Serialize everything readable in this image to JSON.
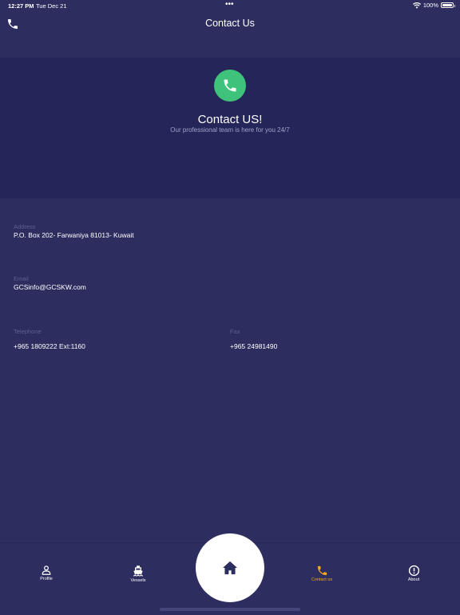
{
  "status_bar": {
    "time": "12:27 PM",
    "date": "Tue Dec 21",
    "dots": "•••",
    "battery_text": "100%",
    "battery_level": 1.0,
    "icons": [
      "wifi-icon",
      "battery-icon"
    ]
  },
  "header": {
    "title": "Contact Us",
    "left_icon": "phone-icon"
  },
  "hero": {
    "icon": "phone-icon",
    "title": "Contact US!",
    "subtitle": "Our professional team is here for you 24/7"
  },
  "contact": {
    "address_label": "Address",
    "address_value": "P.O. Box 202- Farwaniya 81013- Kuwait",
    "email_label": "Email",
    "email_value": "GCSinfo@GCSKW.com",
    "telephone_label": "Telephone",
    "telephone_value": "+965 1809222 Ext:1160",
    "fax_label": "Fax",
    "fax_value": "+965 24981490"
  },
  "tab_bar": {
    "tabs": [
      {
        "label": "Profile",
        "icon": "user-icon",
        "active": false
      },
      {
        "label": "Vessels",
        "icon": "ship-icon",
        "active": false
      },
      {
        "label": "Contact us",
        "icon": "phone-icon",
        "active": true
      },
      {
        "label": "About",
        "icon": "info-icon",
        "active": false
      }
    ],
    "home_icon": "home-icon"
  },
  "colors": {
    "background": "#2d2e5f",
    "hero_background": "#24265a",
    "accent_green": "#3fc37a",
    "active_tab": "#f5a623",
    "label_muted": "#5d6092"
  }
}
